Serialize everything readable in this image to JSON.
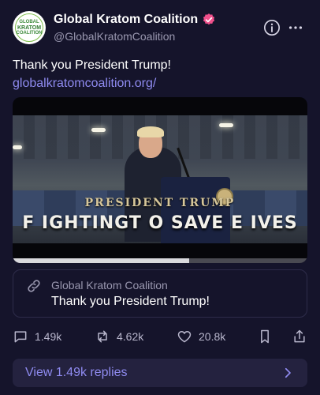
{
  "account": {
    "display_name": "Global Kratom Coalition",
    "handle": "@GlobalKratomCoalition",
    "avatar_text_top": "GLOBAL",
    "avatar_text_mid": "KRATOM",
    "avatar_text_bottom": "COALITION",
    "verified_color": "#f0508c"
  },
  "post": {
    "text": "Thank you President Trump!",
    "link": "globalkratomcoalition.org/"
  },
  "video": {
    "caption_top": "PRESIDENT TRUMP",
    "caption_bottom": "F IGHTINGT O SAVE  E IVES",
    "progress_fraction": 0.6
  },
  "quote": {
    "title": "Global Kratom Coalition",
    "text": "Thank you President Trump!"
  },
  "actions": {
    "replies": "1.49k",
    "reposts": "4.62k",
    "likes": "20.8k"
  },
  "replies_button": {
    "label": "View 1.49k replies"
  },
  "colors": {
    "background": "#15142b",
    "accent": "#8f8bf0",
    "muted": "#9a98b0"
  }
}
